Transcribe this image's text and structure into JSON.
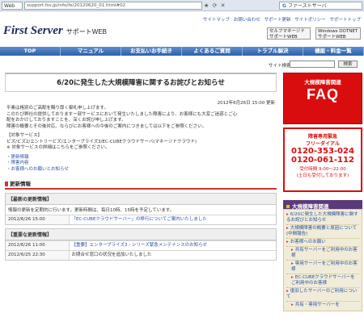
{
  "browser": {
    "web_button": "Web",
    "url": "support.fsv.jp/info/fe/20120620_01.html#02",
    "search_g": "G",
    "search_text": "ファーストサーバ"
  },
  "header": {
    "topnav": [
      "サイトマップ",
      "お問い合わせ",
      "サポート更新",
      "サイトポリシー",
      "サポートトップ"
    ],
    "logo_main": "First Server",
    "logo_sub": "サポートWEB",
    "badge1": "セルフマネージド\nサポートWEB",
    "badge2": "Windows DOTNET\nサポートWEB"
  },
  "mainnav": [
    "TOP",
    "マニュアル",
    "お支払いお手続き",
    "よくあるご質問",
    "トラブル解決",
    "機能・料金一覧"
  ],
  "sitesearch": {
    "label": "サイト検索",
    "button": "検索"
  },
  "article": {
    "title": "6/20に発生した大規模障害に関するお詫びとお知らせ",
    "date": "2012年6月26日 15:00 更新",
    "para1": [
      "平素は格別のご高配を賜り厚く御礼申し上げます。",
      "このたび弊社の提供しておりますー部サービスにおいて発生いたしました障害により、お客様にも大変ご迷惑とご心",
      "配をおかけしておりますことを、深くお詫び申し上げます。",
      "障害の概要とその後対応、ならびにお客様への今後のご案内につきましては以下をご参照ください。"
    ],
    "para2": [
      "【対象サービス】",
      "ビズ/ビズ2/エントリービズ/エンタープライズ3/EC-CUBEクラウドサーバ(マネージドクラウド)",
      "※ 対象サービスの詳細はこちらをご参照ください。"
    ],
    "links": [
      "・更新情報",
      "・障害内容",
      "・お客様へのお願いとお知らせ"
    ],
    "update_heading": "更新情報",
    "latest": {
      "head": "【最新の更新情報】",
      "note": "情報の更新を定期的に行います。更新時間は、毎日10時、15時を予定しています。",
      "rows": [
        {
          "date": "2012/6/26 15:00",
          "text": "「EC-CUBEクラウドサーバー」の移行についてご案内いたしました"
        }
      ]
    },
    "important": {
      "head": "【重要な更新情報】",
      "rows": [
        {
          "date": "2012/6/26 11:00",
          "text": "【重要】エンタープライズ3・シリーズ緊急メンテナンスのお知らせ"
        },
        {
          "date": "2012/6/25 22:30",
          "text": "お問合せ窓口の状況を追加いたしました"
        }
      ]
    }
  },
  "side": {
    "faq_t1": "大規模障害関連",
    "faq_t2": "FAQ",
    "tel_h1": "障害専用緊急",
    "tel_h2": "フリーダイアル",
    "tel1": "0120-353-024",
    "tel2": "0120-061-112",
    "hours": "受付時間 9:00～22:00",
    "hours2": "(土日も受付しております)",
    "list_head": "大規模障害関連",
    "items": [
      "6/20に発生した大規模障害に関するお詫びとお知らせ",
      "大規模障害の概要と原因について(中間報告)",
      "お客様へのお願い",
      "共有サーバーをご利用中のお客様",
      "専用サーバーをご利用中のお客様",
      "EC-CUBEクラウドサーバーをご利用中のお客様",
      "復旧したサーバーのご利用について",
      "共有・専用サーバーを"
    ]
  }
}
